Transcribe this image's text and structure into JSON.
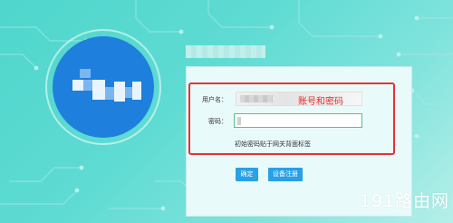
{
  "colors": {
    "background": "#5edbd3",
    "panel": "#e9fafa",
    "logo": "#1f7fdc",
    "button": "#2aa0e6",
    "annotation": "#e53232",
    "password_border": "#56c38b"
  },
  "login": {
    "username_label": "用户名：",
    "username_value": "",
    "password_label": "密码：",
    "password_value": "",
    "hint": "初始密码贴于网关背面标签",
    "confirm_button": "确定",
    "register_button": "设备注册"
  },
  "annotation": {
    "text": "账号和密码"
  },
  "watermark": {
    "text": "191路由网"
  },
  "icons": {
    "logo": "router-brand-logo-icon"
  }
}
